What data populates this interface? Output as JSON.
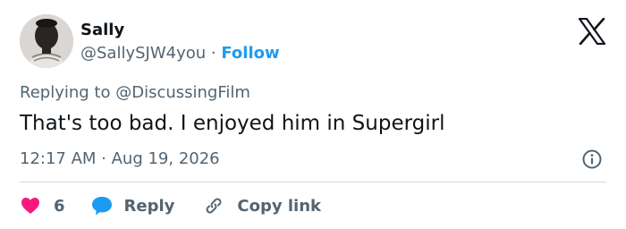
{
  "author": {
    "name": "Sally",
    "handle": "@SallySJW4you",
    "separator": " · ",
    "follow_label": "Follow"
  },
  "reply_context": {
    "prefix": "Replying to ",
    "mention": "@DiscussingFilm"
  },
  "tweet": {
    "text": "That's too bad. I enjoyed him in Supergirl",
    "timestamp": "12:17 AM · Aug 19, 2026"
  },
  "actions": {
    "like_count": "6",
    "reply_label": "Reply",
    "copy_link_label": "Copy link"
  },
  "icons": {
    "brand": "x-logo-icon",
    "info": "info-icon",
    "like": "heart-icon",
    "reply": "speech-bubble-icon",
    "copy": "link-icon"
  },
  "colors": {
    "accent": "#1d9bf0",
    "like": "#f91880",
    "secondary_text": "#536471",
    "primary_text": "#0f1419",
    "divider": "#cfd9de"
  }
}
